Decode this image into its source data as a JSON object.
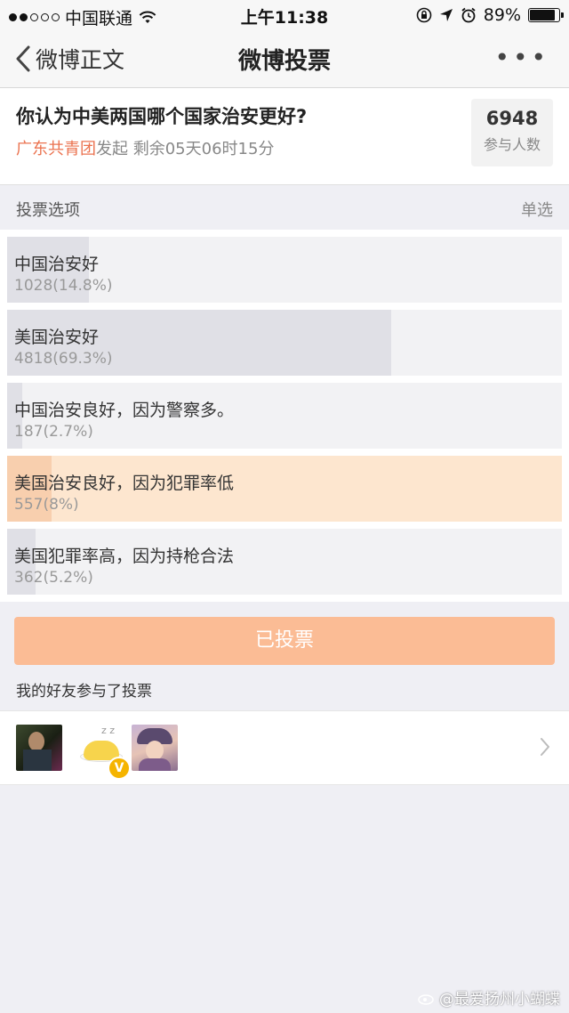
{
  "status_bar": {
    "carrier": "中国联通",
    "time": "上午11:38",
    "battery": "89%",
    "battery_level": 0.89,
    "icons": [
      "wifi-icon",
      "lock-rotation-icon",
      "location-icon",
      "alarm-icon",
      "battery-icon"
    ]
  },
  "nav": {
    "back_label": "微博正文",
    "title": "微博投票",
    "more_label": "•••"
  },
  "poll": {
    "question": "你认为中美两国哪个国家治安更好?",
    "organizer": "广东共青团",
    "organizer_suffix": "发起",
    "remaining": "剩余05天06时15分",
    "participants_count": "6948",
    "participants_label": "参与人数"
  },
  "options_header": {
    "title": "投票选项",
    "mode": "单选"
  },
  "options": [
    {
      "label": "中国治安好",
      "count": "1028(14.8%)",
      "fraction": 0.148,
      "selected": false
    },
    {
      "label": "美国治安好",
      "count": "4818(69.3%)",
      "fraction": 0.693,
      "selected": false
    },
    {
      "label": "中国治安良好，因为警察多。",
      "count": "187(2.7%)",
      "fraction": 0.027,
      "selected": false
    },
    {
      "label": "美国治安良好，因为犯罪率低",
      "count": "557(8%)",
      "fraction": 0.08,
      "selected": true
    },
    {
      "label": "美国犯罪率高，因为持枪合法",
      "count": "362(5.2%)",
      "fraction": 0.052,
      "selected": false
    }
  ],
  "vote_button": {
    "label": "已投票"
  },
  "friends": {
    "label": "我的好友参与了投票",
    "verify_badge": "V"
  },
  "watermark": "@最爱扬州小蝴蝶",
  "colors": {
    "accent": "#eb7350",
    "selected_bar": "#f8cfae",
    "voted_button": "#fbbc95"
  }
}
